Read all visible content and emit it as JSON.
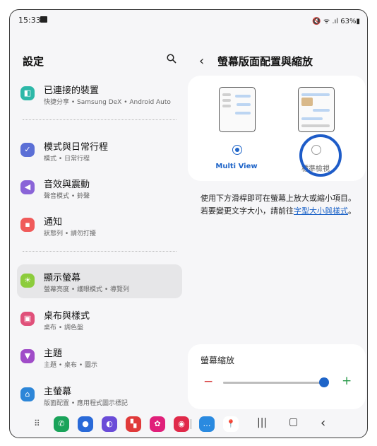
{
  "status": {
    "time": "15:33",
    "right": "🔇 ᯤ .ıl 63%▮"
  },
  "settings": {
    "title": "設定",
    "items": [
      {
        "title": "已連接的裝置",
        "sub": "快捷分享 • Samsung DeX • Android Auto",
        "color": "#2db8a8",
        "glyph": "◧",
        "icon": "connected-devices-icon"
      },
      {
        "title": "模式與日常行程",
        "sub": "模式 • 日常行程",
        "color": "#5b6fd6",
        "glyph": "✓",
        "icon": "modes-icon"
      },
      {
        "title": "音效與震動",
        "sub": "聲音模式 • 鈴聲",
        "color": "#8a64d8",
        "glyph": "◀",
        "icon": "sound-icon"
      },
      {
        "title": "通知",
        "sub": "狀態列 • 請勿打擾",
        "color": "#f05a5a",
        "glyph": "▪",
        "icon": "notifications-icon"
      },
      {
        "title": "顯示螢幕",
        "sub": "螢幕亮度 • 護眼模式 • 導覽列",
        "color": "#8ccc3c",
        "glyph": "☀",
        "icon": "display-icon"
      },
      {
        "title": "桌布與樣式",
        "sub": "桌布 • 調色盤",
        "color": "#e0507a",
        "glyph": "▣",
        "icon": "wallpaper-icon"
      },
      {
        "title": "主題",
        "sub": "主題 • 桌布 • 圖示",
        "color": "#a04cc8",
        "glyph": "▼",
        "icon": "themes-icon"
      },
      {
        "title": "主螢幕",
        "sub": "版面配置 • 應用程式圖示標記",
        "color": "#2d86d8",
        "glyph": "⌂",
        "icon": "home-screen-icon"
      }
    ],
    "active_index": 4
  },
  "detail": {
    "title": "螢幕版面配置與縮放",
    "options": [
      {
        "label": "Multi View",
        "selected": true
      },
      {
        "label": "標準檢視",
        "selected": false
      }
    ],
    "desc_plain": "使用下方滑桿即可在螢幕上放大或縮小項目。若要變更文字大小，請前往",
    "desc_link": "字型大小與樣式",
    "desc_end": "。",
    "zoom_label": "螢幕縮放",
    "zoom_value": 0.95,
    "minus": "−",
    "plus": "+"
  },
  "dock": [
    {
      "name": "phone",
      "color": "#1aa35a",
      "glyph": "✆"
    },
    {
      "name": "messages",
      "color": "#2a6ad8",
      "glyph": "●"
    },
    {
      "name": "internet",
      "color": "#6a4cd8",
      "glyph": "◐"
    },
    {
      "name": "flipboard",
      "color": "#e03a3a",
      "glyph": "▚"
    },
    {
      "name": "bixby",
      "color": "#e0207a",
      "glyph": "✿"
    },
    {
      "name": "camera",
      "color": "#e02a4a",
      "glyph": "◉"
    },
    {
      "name": "chat",
      "color": "#2a8ae0",
      "glyph": "…"
    },
    {
      "name": "maps",
      "color": "#ffffff",
      "glyph": "📍"
    }
  ]
}
